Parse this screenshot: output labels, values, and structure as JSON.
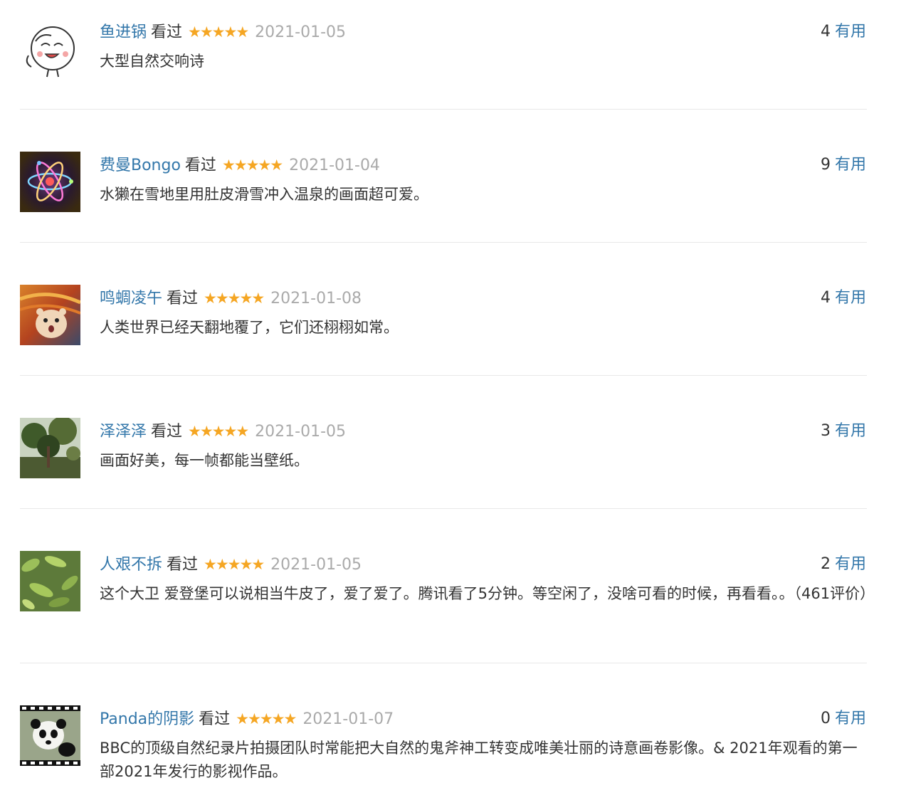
{
  "comments": [
    {
      "user": "鱼进锅",
      "status": "看过",
      "rating": 5,
      "stars": "★★★★★",
      "date": "2021-01-05",
      "useful_count": "4",
      "useful_label": "有用",
      "text": "大型自然交响诗",
      "avatar": "cartoon-face-avatar"
    },
    {
      "user": "费曼Bongo",
      "status": "看过",
      "rating": 5,
      "stars": "★★★★★",
      "date": "2021-01-04",
      "useful_count": "9",
      "useful_label": "有用",
      "text": "水獭在雪地里用肚皮滑雪冲入温泉的画面超可爱。",
      "avatar": "atom-avatar"
    },
    {
      "user": "鸣蜩凌午",
      "status": "看过",
      "rating": 5,
      "stars": "★★★★★",
      "date": "2021-01-08",
      "useful_count": "4",
      "useful_label": "有用",
      "text": "人类世界已经天翻地覆了，它们还栩栩如常。",
      "avatar": "hamster-scream-avatar"
    },
    {
      "user": "泽泽泽",
      "status": "看过",
      "rating": 5,
      "stars": "★★★★★",
      "date": "2021-01-05",
      "useful_count": "3",
      "useful_label": "有用",
      "text": "画面好美，每一帧都能当壁纸。",
      "avatar": "forest-avatar"
    },
    {
      "user": "人艰不拆",
      "status": "看过",
      "rating": 5,
      "stars": "★★★★★",
      "date": "2021-01-05",
      "useful_count": "2",
      "useful_label": "有用",
      "text": "这个大卫 爱登堡可以说相当牛皮了，爱了爱了。腾讯看了5分钟。等空闲了，没啥可看的时候，再看看。。（461评价）",
      "avatar": "leaves-avatar"
    },
    {
      "user": "Panda的阴影",
      "status": "看过",
      "rating": 5,
      "stars": "★★★★★",
      "date": "2021-01-07",
      "useful_count": "0",
      "useful_label": "有用",
      "text": "BBC的顶级自然纪录片拍摄团队时常能把大自然的鬼斧神工转变成唯美壮丽的诗意画卷影像。& 2021年观看的第一部2021年发行的影视作品。",
      "avatar": "panda-film-avatar"
    }
  ]
}
